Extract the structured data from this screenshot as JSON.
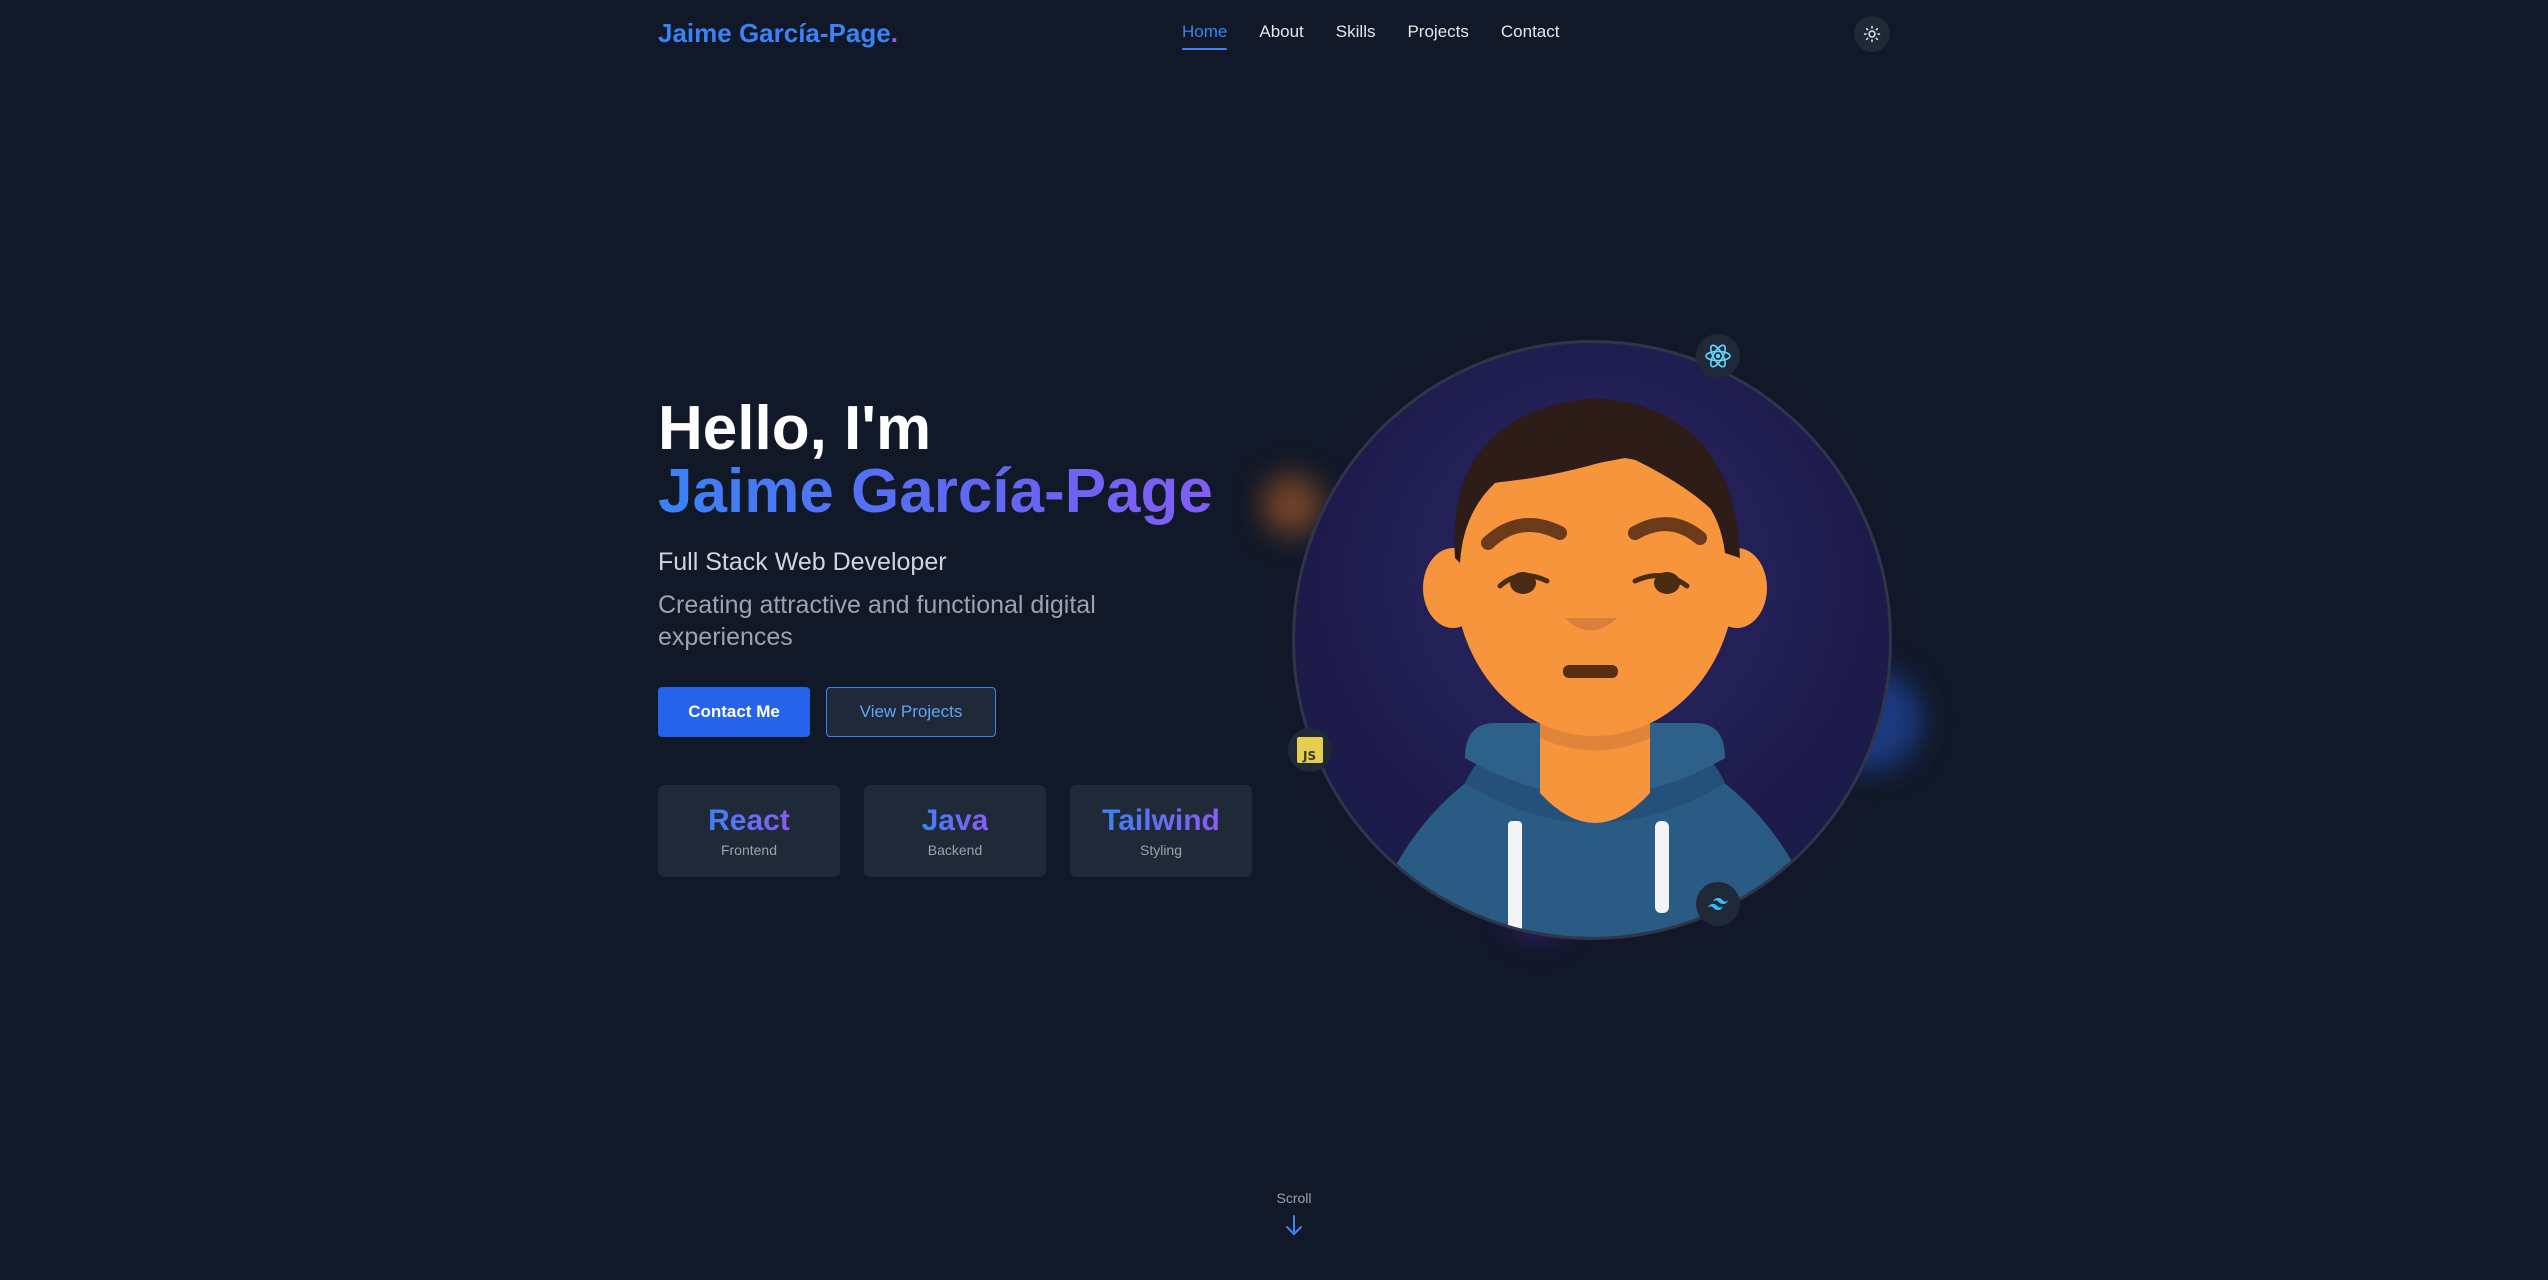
{
  "nav": {
    "logo_text": "Jaime García-Page",
    "logo_dot": ".",
    "links": [
      {
        "label": "Home",
        "active": true
      },
      {
        "label": "About",
        "active": false
      },
      {
        "label": "Skills",
        "active": false
      },
      {
        "label": "Projects",
        "active": false
      },
      {
        "label": "Contact",
        "active": false
      }
    ],
    "theme_icon": "sun-icon"
  },
  "hero": {
    "greeting": "Hello, I'm",
    "name": "Jaime García-Page",
    "role": "Full Stack Web Developer",
    "tagline": "Creating attractive and functional digital experiences",
    "primary_button": "Contact Me",
    "secondary_button": "View Projects",
    "skills": [
      {
        "name": "React",
        "sub": "Frontend"
      },
      {
        "name": "Java",
        "sub": "Backend"
      },
      {
        "name": "Tailwind",
        "sub": "Styling"
      }
    ]
  },
  "avatar": {
    "badges": [
      "react-icon",
      "javascript-icon",
      "tailwind-icon"
    ],
    "js_label": "JS"
  },
  "scroll": {
    "label": "Scroll",
    "icon": "arrow-down-icon"
  },
  "colors": {
    "background": "#111827",
    "accent": "#3b82f6",
    "accent_2": "#8b5cf6",
    "card": "#1f2937"
  }
}
